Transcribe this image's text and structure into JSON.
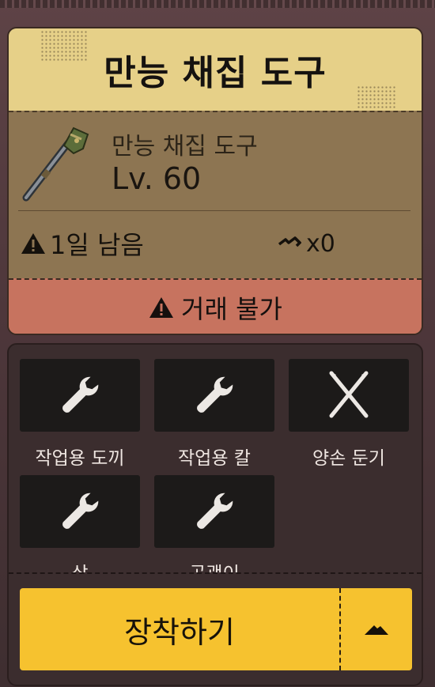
{
  "item": {
    "title": "만능 채집 도구",
    "name": "만능 채집 도구",
    "level": "Lv. 60",
    "days_left": "1일 남음",
    "repair_count": "x0",
    "trade_status": "거래 불가",
    "icon": "shovel-tool-icon"
  },
  "tools": [
    {
      "label": "작업용 도끼",
      "icon": "wrench-icon"
    },
    {
      "label": "작업용 칼",
      "icon": "wrench-icon"
    },
    {
      "label": "양손 둔기",
      "icon": "crossed-swords-icon"
    },
    {
      "label": "삽",
      "icon": "wrench-icon"
    },
    {
      "label": "곡괭이",
      "icon": "wrench-icon"
    }
  ],
  "actions": {
    "equip_label": "장착하기",
    "expand_icon": "caret-up-icon"
  },
  "colors": {
    "header": "#e6d088",
    "body": "#8d7552",
    "untradeable": "#c7735f",
    "panel": "#3b2d2e",
    "button": "#f6c22f"
  }
}
